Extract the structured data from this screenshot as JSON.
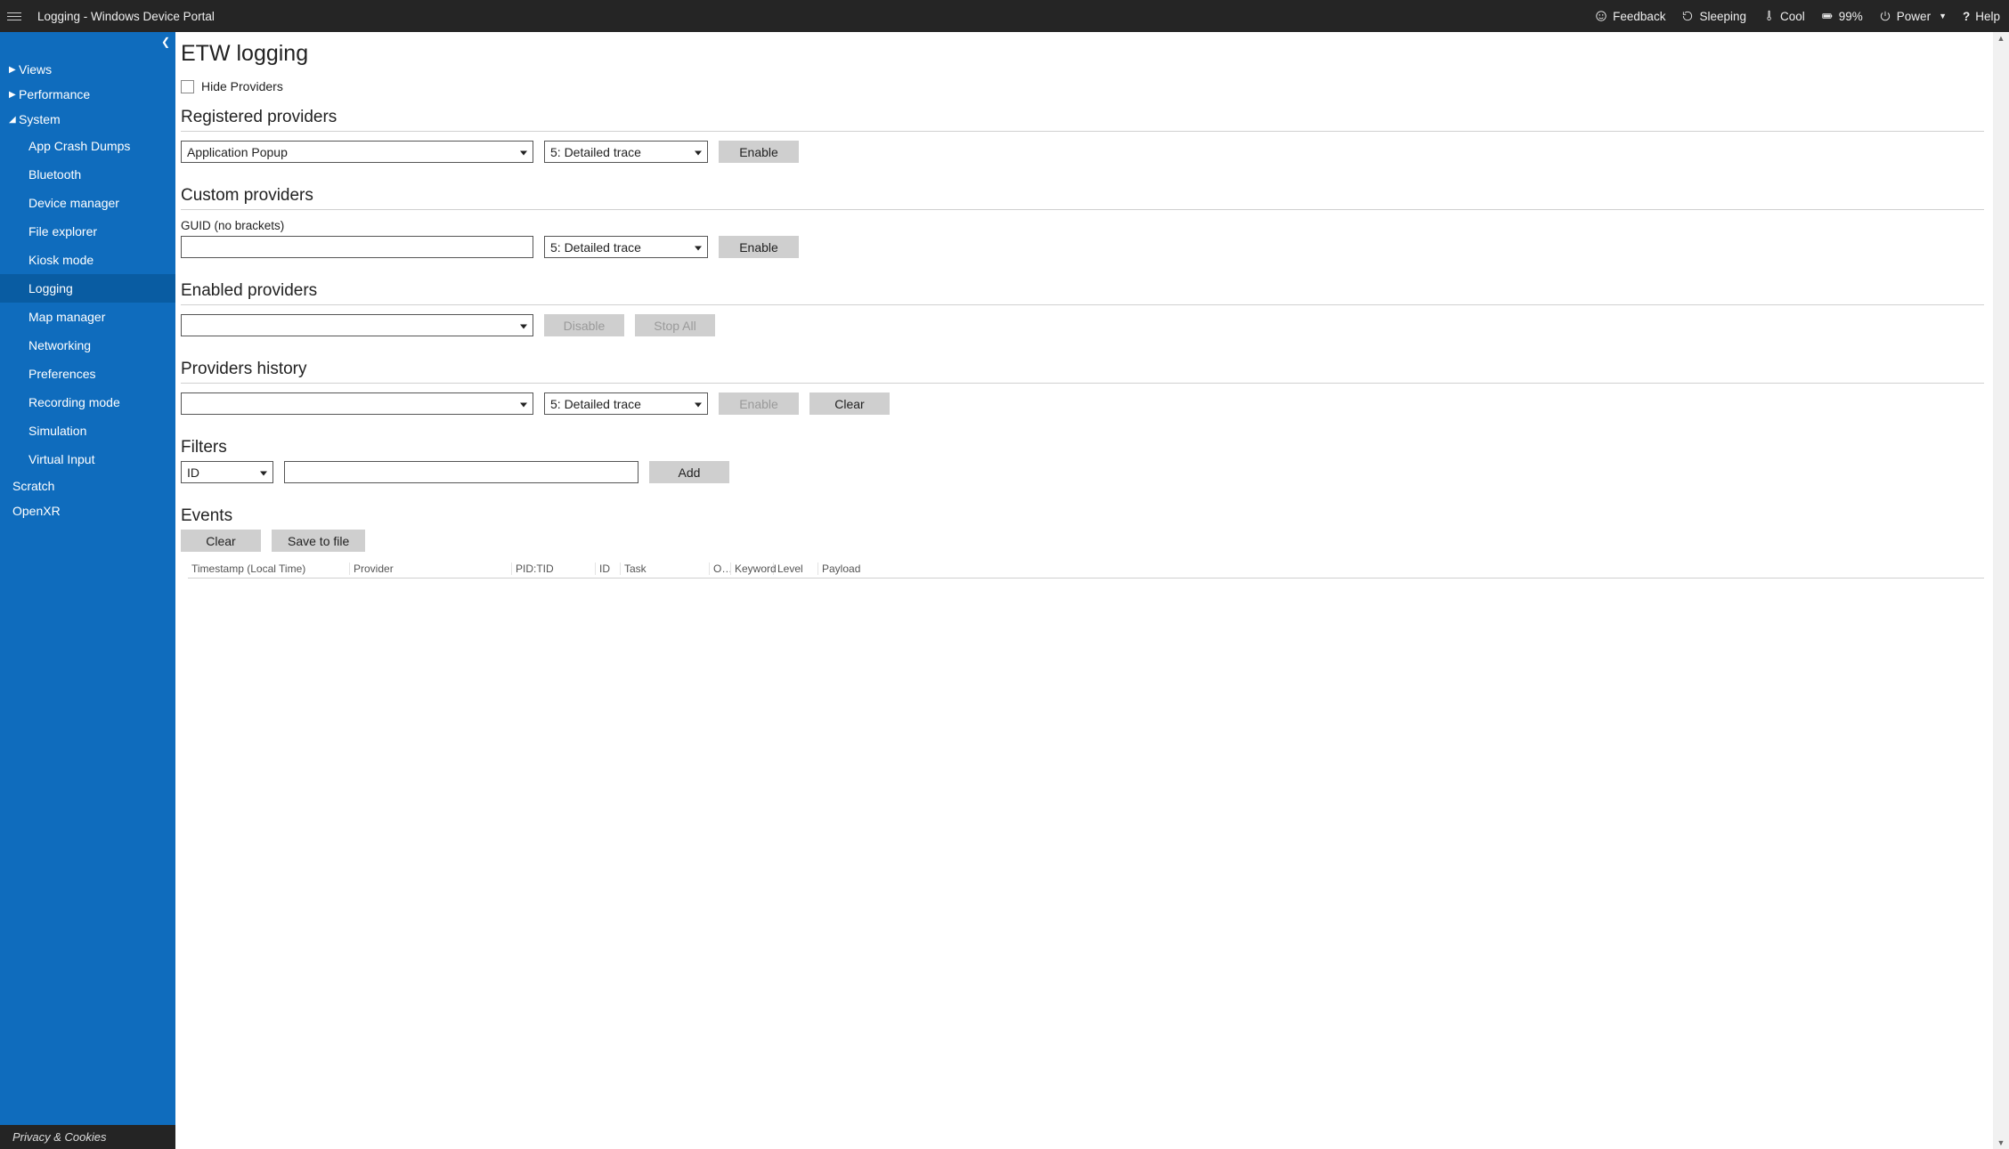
{
  "header": {
    "title": "Logging - Windows Device Portal",
    "feedback": "Feedback",
    "sleeping": "Sleeping",
    "cool": "Cool",
    "battery": "99%",
    "power": "Power",
    "help": "Help"
  },
  "sidebar": {
    "views": "Views",
    "performance": "Performance",
    "system": "System",
    "system_items": {
      "0": "App Crash Dumps",
      "1": "Bluetooth",
      "2": "Device manager",
      "3": "File explorer",
      "4": "Kiosk mode",
      "5": "Logging",
      "6": "Map manager",
      "7": "Networking",
      "8": "Preferences",
      "9": "Recording mode",
      "10": "Simulation",
      "11": "Virtual Input"
    },
    "scratch": "Scratch",
    "openxr": "OpenXR",
    "footer": "Privacy & Cookies"
  },
  "page": {
    "title": "ETW logging",
    "hide_providers": "Hide Providers",
    "registered": {
      "heading": "Registered providers",
      "provider_value": "Application Popup",
      "level_value": "5: Detailed trace",
      "enable": "Enable"
    },
    "custom": {
      "heading": "Custom providers",
      "hint": "GUID (no brackets)",
      "level_value": "5: Detailed trace",
      "enable": "Enable"
    },
    "enabled": {
      "heading": "Enabled providers",
      "disable": "Disable",
      "stop_all": "Stop All"
    },
    "history": {
      "heading": "Providers history",
      "level_value": "5: Detailed trace",
      "enable": "Enable",
      "clear": "Clear"
    },
    "filters": {
      "heading": "Filters",
      "field_value": "ID",
      "add": "Add"
    },
    "events": {
      "heading": "Events",
      "clear": "Clear",
      "save": "Save to file",
      "cols": {
        "ts": "Timestamp (Local Time)",
        "prov": "Provider",
        "pid": "PID:TID",
        "id": "ID",
        "task": "Task",
        "op": "O…",
        "kw": "Keyword",
        "lvl": "Level",
        "payload": "Payload"
      }
    }
  }
}
